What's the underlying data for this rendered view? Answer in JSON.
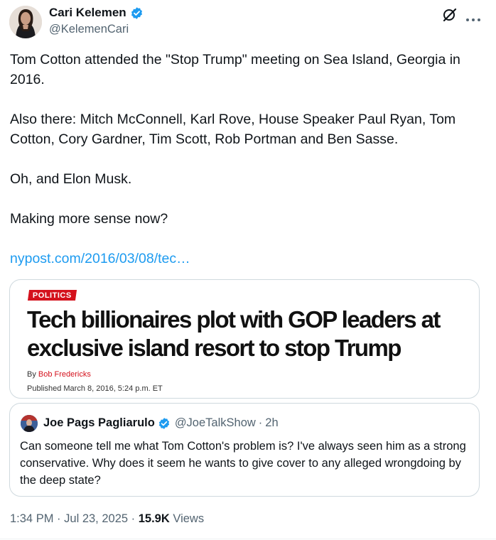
{
  "tweet": {
    "author": {
      "name": "Cari Kelemen",
      "handle": "@KelemenCari"
    },
    "body": {
      "p1": "Tom Cotton attended the \"Stop Trump\" meeting on Sea Island, Georgia in 2016.",
      "p2": "Also there: Mitch McConnell, Karl Rove, House Speaker Paul Ryan, Tom Cotton, Cory Gardner, Tim Scott, Rob Portman and Ben Sasse.",
      "p3": "Oh, and Elon Musk.",
      "p4": "Making more sense now?",
      "link": "nypost.com/2016/03/08/tec…"
    },
    "card": {
      "kicker": "POLITICS",
      "headline": "Tech billionaires plot with GOP leaders at exclusive island resort to stop Trump",
      "by_prefix": "By",
      "byline_author": "Bob Fredericks",
      "published": "Published March 8, 2016, 5:24 p.m. ET"
    },
    "quote": {
      "name": "Joe Pags Pagliarulo",
      "handle": "@JoeTalkShow",
      "separator": "·",
      "time": "2h",
      "text": "Can someone tell me what Tom Cotton's problem is?  I've always seen him as a strong conservative.  Why does it seem he wants to give cover to any alleged wrongdoing by the deep state?"
    },
    "meta": {
      "time": "1:34 PM",
      "separator": "·",
      "date": "Jul 23, 2025",
      "views_count": "15.9K",
      "views_label": "Views"
    }
  },
  "icons": {
    "verified": "verified-badge-icon",
    "grok": "grok-icon",
    "more": "more-icon"
  },
  "colors": {
    "link": "#1d9bf0",
    "secondary_text": "#536471",
    "kicker": "#d4111c"
  }
}
